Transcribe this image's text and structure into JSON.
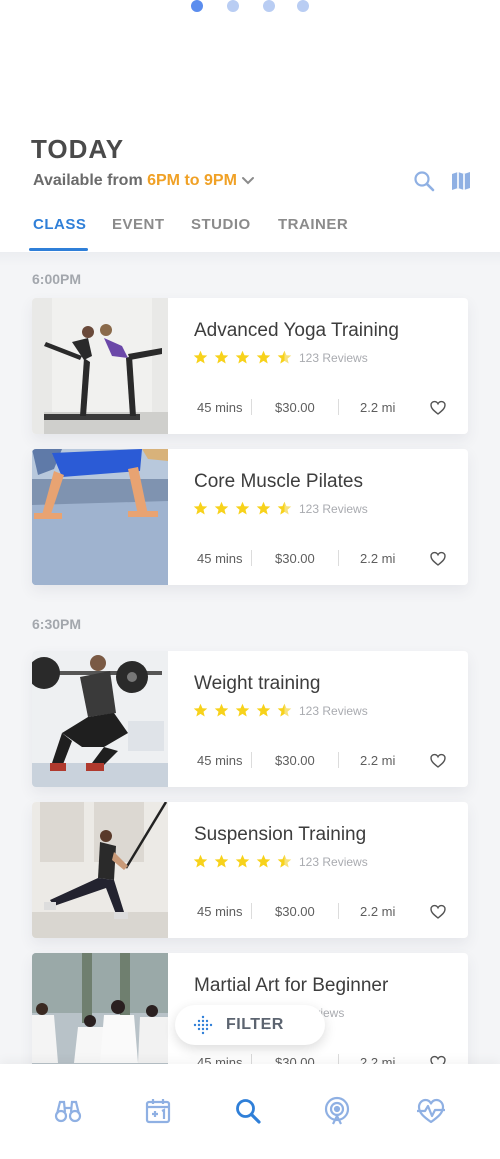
{
  "page_indicator": {
    "count": 4,
    "active_index": 0
  },
  "header": {
    "title": "TODAY",
    "available_prefix": "Available from ",
    "available_range": "6PM to 9PM",
    "search_icon": "search-icon",
    "map_icon": "map-icon"
  },
  "tabs": [
    {
      "label": "CLASS",
      "active": true
    },
    {
      "label": "EVENT",
      "active": false
    },
    {
      "label": "STUDIO",
      "active": false
    },
    {
      "label": "TRAINER",
      "active": false
    }
  ],
  "time_slots": [
    "6:00PM",
    "6:30PM"
  ],
  "classes": [
    {
      "title": "Advanced Yoga Training",
      "rating": 4.5,
      "reviews": "123 Reviews",
      "duration": "45 mins",
      "price": "$30.00",
      "distance": "2.2 mi"
    },
    {
      "title": "Core Muscle Pilates",
      "rating": 4.5,
      "reviews": "123 Reviews",
      "duration": "45 mins",
      "price": "$30.00",
      "distance": "2.2 mi"
    },
    {
      "title": "Weight training",
      "rating": 4.5,
      "reviews": "123 Reviews",
      "duration": "45 mins",
      "price": "$30.00",
      "distance": "2.2 mi"
    },
    {
      "title": "Suspension Training",
      "rating": 4.5,
      "reviews": "123 Reviews",
      "duration": "45 mins",
      "price": "$30.00",
      "distance": "2.2 mi"
    },
    {
      "title": "Martial Art for Beginner",
      "rating": 4.5,
      "reviews": "Reviews",
      "duration": "45 mins",
      "price": "$30.00",
      "distance": "2.2 mi"
    }
  ],
  "filter": {
    "label": "FILTER"
  },
  "bottom_nav": [
    {
      "icon": "binoculars-icon",
      "active": false
    },
    {
      "icon": "calendar-plus-icon",
      "active": false
    },
    {
      "icon": "search-icon",
      "active": true
    },
    {
      "icon": "broadcast-icon",
      "active": false
    },
    {
      "icon": "heart-pulse-icon",
      "active": false
    }
  ],
  "colors": {
    "accent": "#2f7fd8",
    "highlight": "#f0a126",
    "star": "#f7d21b",
    "inactive_icon": "#8fb0e3"
  }
}
